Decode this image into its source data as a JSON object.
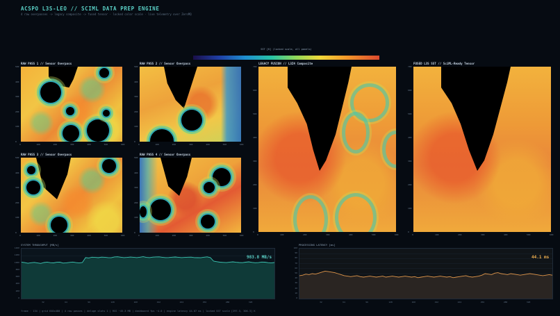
{
  "header": {
    "title": "ACSPO L3S-LEO  //  SCIML DATA PREP ENGINE",
    "subtitle": "4 raw overpasses -> legacy composite -> fused tensor  ·  locked color scale  ·  live telemetry over ZeroMQ"
  },
  "colorbar": {
    "label": "SST [K]  (locked scale, all panels)",
    "ticks": [
      "",
      "",
      "",
      "",
      "",
      ""
    ],
    "colors": [
      "#1a0f4a",
      "#1f3fa5",
      "#1f8fd0",
      "#27c3a6",
      "#8fd85a",
      "#f0d93a",
      "#f49a2a",
      "#dc4a2f"
    ]
  },
  "panels": [
    {
      "id": "raw1",
      "title": "RAW PASS 1  //  Sensor Overpass"
    },
    {
      "id": "raw2",
      "title": "RAW PASS 2  //  Sensor Overpass"
    },
    {
      "id": "raw3",
      "title": "RAW PASS 3  //  Sensor Overpass"
    },
    {
      "id": "raw4",
      "title": "RAW PASS 4  //  Sensor Overpass"
    },
    {
      "id": "legacy",
      "title": "LEGACY FUSION  //  L3Z4 Composite"
    },
    {
      "id": "fused",
      "title": "FUSED L3S SST  //  SciML-Ready Tensor"
    }
  ],
  "axes": {
    "small_x": [
      "0",
      "100",
      "200",
      "300",
      "400",
      "500",
      "600"
    ],
    "small_y": [
      "0",
      "100",
      "200",
      "300",
      "400",
      "500"
    ],
    "big_x": [
      "0",
      "100",
      "200",
      "300",
      "400",
      "500",
      "600"
    ],
    "big_y": [
      "0",
      "100",
      "200",
      "300",
      "400",
      "500",
      "600",
      "700"
    ]
  },
  "throughput": {
    "title": "SYSTEM THROUGHPUT  [MB/s]",
    "readout": "983.8 MB/s",
    "color": "#3cc7b4",
    "fill": "#0f3a38",
    "yticks": [
      "0",
      "200",
      "400",
      "600",
      "800",
      "1000",
      "1200",
      "1400"
    ],
    "xticks": [
      "32",
      "64",
      "96",
      "128",
      "160",
      "192",
      "224",
      "256",
      "288",
      "320"
    ],
    "ymax": 1400,
    "values": [
      1020,
      1010,
      990,
      1005,
      1015,
      1000,
      985,
      1012,
      1022,
      1008,
      1002,
      1018,
      1020,
      995,
      1003,
      1015,
      1025,
      1010,
      1000,
      1012,
      1150,
      1140,
      1160,
      1155,
      1148,
      1162,
      1158,
      1150,
      1145,
      1168,
      1172,
      1160,
      1150,
      1155,
      1164,
      1158,
      1149,
      1160,
      1175,
      1155,
      1150,
      1162,
      1168,
      1170,
      1158,
      1150,
      1152,
      1160,
      1166,
      1158,
      1150,
      1155,
      1160,
      1163,
      1150,
      1148,
      1145,
      1160,
      1170,
      1150,
      1050,
      1035,
      1020,
      1015,
      1010,
      1022,
      1030,
      1018,
      1012,
      1008,
      1020,
      1030,
      1015,
      1005,
      1010,
      1025,
      1020,
      1008,
      1000,
      1012
    ]
  },
  "latency": {
    "title": "PROCESSING LATENCY  [ms]",
    "readout": "44.1 ms",
    "color": "#e0964a",
    "fill": "#2a2522",
    "yticks": [
      "0",
      "10",
      "20",
      "30",
      "40",
      "50",
      "60",
      "70",
      "80",
      "90",
      "100"
    ],
    "xticks": [
      "32",
      "64",
      "96",
      "128",
      "160",
      "192",
      "224",
      "256",
      "288",
      "320"
    ],
    "ymax": 100,
    "values": [
      46,
      47,
      49,
      48,
      50,
      49,
      51,
      53,
      55,
      54,
      53,
      52,
      50,
      48,
      46,
      45,
      44,
      45,
      46,
      44,
      43,
      44,
      45,
      44,
      43,
      44,
      45,
      43,
      44,
      45,
      44,
      43,
      44,
      45,
      44,
      43,
      44,
      42,
      43,
      44,
      45,
      44,
      43,
      44,
      45,
      44,
      43,
      44,
      42,
      43,
      44,
      45,
      46,
      44,
      43,
      44,
      45,
      47,
      50,
      49,
      48,
      51,
      52,
      50,
      49,
      48,
      50,
      49,
      48,
      47,
      48,
      49,
      50,
      49,
      48,
      47,
      46,
      47,
      48,
      47
    ]
  },
  "footer": {
    "text": "frame  ·  134  |  grid 640x480  |  4 raw passes  |  deluge slots 1  |  RSS  ~45.3 MB  |  dashboard fps  ~4.0  |  engine latency  44.07 ms  |  locked SST scale [297.3, 306.3] K"
  }
}
